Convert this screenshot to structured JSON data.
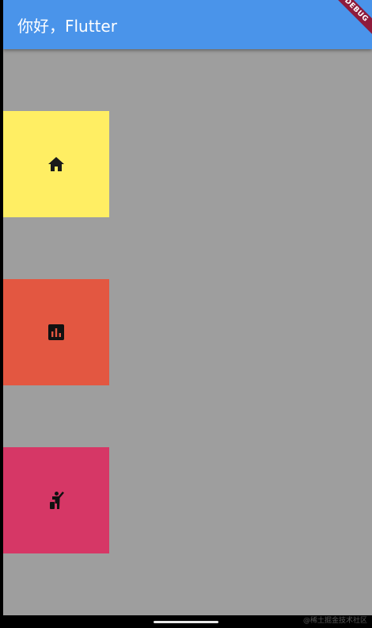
{
  "appbar": {
    "title": "你好，Flutter",
    "color": "#4a94ea",
    "debug_banner": "DEBUG",
    "debug_banner_color": "#8e1b3c"
  },
  "body": {
    "background": "#9e9e9e",
    "tiles": [
      {
        "icon": "home-icon",
        "color": "#ffee63"
      },
      {
        "icon": "bar-chart-icon",
        "color": "#e35741"
      },
      {
        "icon": "accessibility-person-icon",
        "color": "#d63766"
      }
    ]
  },
  "system_nav": {
    "watermark": "@稀土掘金技术社区"
  }
}
